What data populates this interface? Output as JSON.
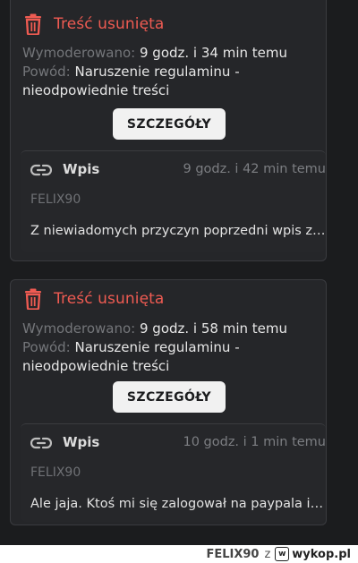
{
  "cards": [
    {
      "title": "Treść usunięta",
      "moderated_label": "Wymoderowano:",
      "moderated_value": "9 godz. i 34 min temu",
      "reason_label": "Powód:",
      "reason_line1": "Naruszenie regulaminu -",
      "reason_line2": "nieodpowiednie treści",
      "button_label": "SZCZEGÓŁY",
      "entry": {
        "type": "Wpis",
        "time": "9 godz. i 42 min temu",
        "author": "FELIX90",
        "text": "Z niewiadomych przyczyn poprzedni wpis zos..."
      }
    },
    {
      "title": "Treść usunięta",
      "moderated_label": "Wymoderowano:",
      "moderated_value": "9 godz. i 58 min temu",
      "reason_label": "Powód:",
      "reason_line1": "Naruszenie regulaminu -",
      "reason_line2": "nieodpowiednie treści",
      "button_label": "SZCZEGÓŁY",
      "entry": {
        "type": "Wpis",
        "time": "10 godz. i 1 min temu",
        "author": "FELIX90",
        "text": "Ale jaja. Ktoś mi się zalogował na paypala i zr..."
      }
    }
  ],
  "footer": {
    "author": "FELIX90",
    "separator": "z",
    "brand": "wykop.pl",
    "logo_glyph": "w"
  },
  "colors": {
    "accent_red": "#ef5b52",
    "background": "#1b1c1e",
    "card": "#252629"
  }
}
